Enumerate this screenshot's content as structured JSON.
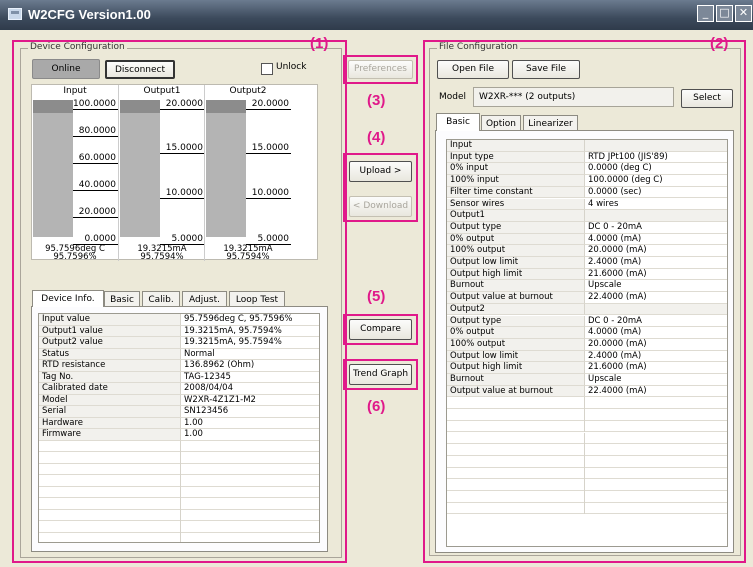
{
  "window": {
    "title": "W2CFG Version1.00",
    "min_glyph": "_",
    "max_glyph": "□",
    "close_glyph": "✕"
  },
  "device_config": {
    "legend": "Device Configuration",
    "online_label": "Online",
    "disconnect_label": "Disconnect",
    "unlock_label": "Unlock",
    "unlock_checked": false,
    "meters": [
      {
        "header": "Input",
        "ticks": [
          "100.0000",
          "80.0000",
          "60.0000",
          "40.0000",
          "20.0000",
          "0.0000"
        ],
        "reading": "95.7596deg C",
        "percent_text": "95.7596%",
        "fill_percent": 95.7596
      },
      {
        "header": "Output1",
        "ticks": [
          "20.0000",
          "15.0000",
          "10.0000",
          "5.0000"
        ],
        "reading": "19.3215mA",
        "percent_text": "95.7594%",
        "fill_percent": 95.7594
      },
      {
        "header": "Output2",
        "ticks": [
          "20.0000",
          "15.0000",
          "10.0000",
          "5.0000"
        ],
        "reading": "19.3215mA",
        "percent_text": "95.7594%",
        "fill_percent": 95.7594
      }
    ],
    "tabs": [
      "Device Info.",
      "Basic",
      "Calib.",
      "Adjust.",
      "Loop Test"
    ],
    "active_tab": "Device Info.",
    "info_rows": [
      [
        "Input value",
        "95.7596deg C, 95.7596%"
      ],
      [
        "Output1 value",
        "19.3215mA, 95.7594%"
      ],
      [
        "Output2 value",
        "19.3215mA, 95.7594%"
      ],
      [
        "Status",
        "Normal"
      ],
      [
        "RTD resistance",
        "136.8962 (Ohm)"
      ],
      [
        "Tag No.",
        "TAG-12345"
      ],
      [
        "Calibrated date",
        "2008/04/04"
      ],
      [
        "Model",
        "W2XR-4Z1Z1-M2"
      ],
      [
        "Serial",
        "SN123456"
      ],
      [
        "Hardware",
        "1.00"
      ],
      [
        "Firmware",
        "1.00"
      ]
    ],
    "empty_rows": 9
  },
  "center": {
    "preferences_label": "Preferences",
    "upload_label": "Upload >",
    "download_label": "< Download",
    "compare_label": "Compare",
    "trend_label": "Trend Graph"
  },
  "file_config": {
    "legend": "File Configuration",
    "open_label": "Open File",
    "save_label": "Save File",
    "model_label": "Model",
    "model_value": "W2XR-*** (2 outputs)",
    "select_label": "Select",
    "tabs": [
      "Basic",
      "Option",
      "Linearizer"
    ],
    "active_tab": "Basic",
    "rows": [
      [
        "Input",
        ""
      ],
      [
        "Input type",
        "RTD JPt100 (JIS'89)"
      ],
      [
        "0% input",
        "0.0000 (deg C)"
      ],
      [
        "100% input",
        "100.0000 (deg C)"
      ],
      [
        "Filter time constant",
        "0.0000 (sec)"
      ],
      [
        "Sensor wires",
        "4 wires"
      ],
      [
        "Output1",
        ""
      ],
      [
        "Output type",
        "DC 0 - 20mA"
      ],
      [
        "0% output",
        "4.0000 (mA)"
      ],
      [
        "100% output",
        "20.0000 (mA)"
      ],
      [
        "Output low limit",
        "2.4000 (mA)"
      ],
      [
        "Output high limit",
        "21.6000 (mA)"
      ],
      [
        "Burnout",
        "Upscale"
      ],
      [
        "Output value at burnout",
        "22.4000 (mA)"
      ],
      [
        "Output2",
        ""
      ],
      [
        "Output type",
        "DC 0 - 20mA"
      ],
      [
        "0% output",
        "4.0000 (mA)"
      ],
      [
        "100% output",
        "20.0000 (mA)"
      ],
      [
        "Output low limit",
        "2.4000 (mA)"
      ],
      [
        "Output high limit",
        "21.6000 (mA)"
      ],
      [
        "Burnout",
        "Upscale"
      ],
      [
        "Output value at burnout",
        "22.4000 (mA)"
      ]
    ],
    "empty_rows": 10
  },
  "annotations": [
    "(1)",
    "(2)",
    "(3)",
    "(4)",
    "(5)",
    "(6)"
  ],
  "colors": {
    "highlight": "#e0198a",
    "window_bg": "#ece9d8",
    "titlebar": "#3c4a5c",
    "meter_bar": "#b4b4b4",
    "online_bg": "#a9a9a9"
  }
}
